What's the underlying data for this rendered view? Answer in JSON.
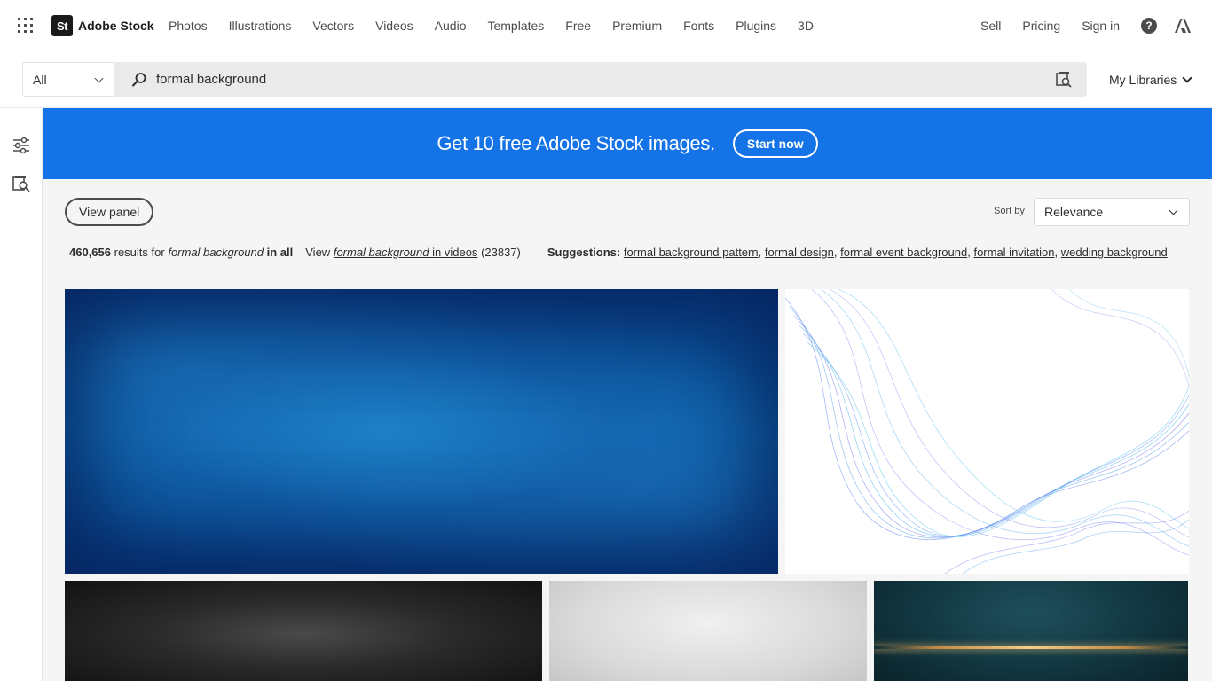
{
  "header": {
    "brand": {
      "logo_mark": "St",
      "name": "Adobe Stock"
    },
    "nav": [
      "Photos",
      "Illustrations",
      "Vectors",
      "Videos",
      "Audio",
      "Templates",
      "Free",
      "Premium",
      "Fonts",
      "Plugins",
      "3D"
    ],
    "right": {
      "sell": "Sell",
      "pricing": "Pricing",
      "sign_in": "Sign in",
      "help_glyph": "?"
    }
  },
  "search": {
    "scope": "All",
    "query": "formal background",
    "libraries": "My Libraries"
  },
  "promo": {
    "text": "Get 10 free Adobe Stock images.",
    "button": "Start now",
    "background_color": "#1473e6"
  },
  "toolbar": {
    "view_panel": "View panel",
    "sort_label": "Sort by",
    "sort_value": "Relevance"
  },
  "results": {
    "count": "460,656",
    "results_for": "results for",
    "term": "formal background",
    "in_all": "in all",
    "view_prefix": "View",
    "in_videos": "in videos",
    "video_count": "(23837)",
    "suggestions_label": "Suggestions:",
    "suggestions": [
      "formal background pattern",
      "formal design",
      "formal event background",
      "formal invitation",
      "wedding background"
    ]
  },
  "icons": {
    "apps": "app-switcher-grid-icon",
    "search": "magnifier-icon",
    "visual_search": "visual-search-icon",
    "filters": "filter-sliders-icon",
    "rail_visual_search": "visual-search-icon",
    "help": "help-icon",
    "adobe": "adobe-logo-icon"
  }
}
